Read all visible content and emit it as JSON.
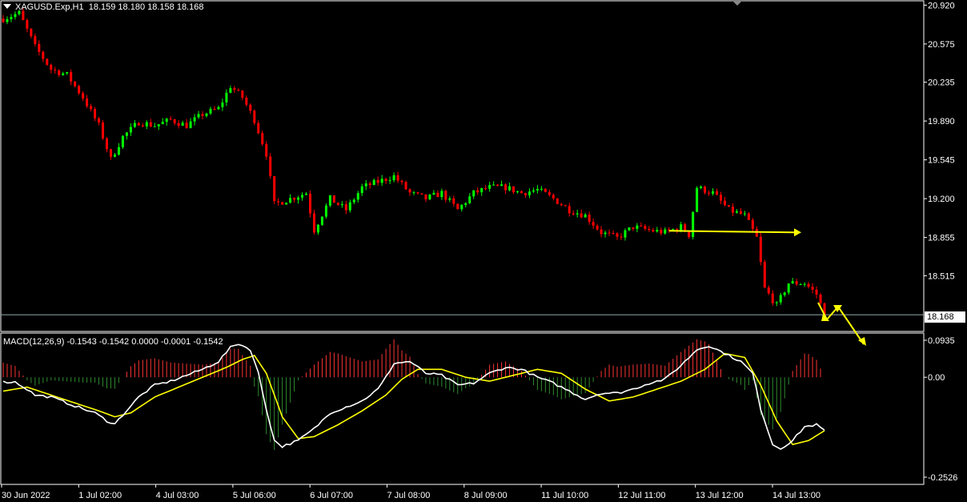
{
  "symbol_header": {
    "symbol": "XAGUSD.Exp,H1",
    "ohlc": "18.159 18.180 18.158 18.168"
  },
  "macd_header": {
    "label": "MACD(12,26,9) -0.1543 -0.1542 0.0000 -0.0001 -0.1542"
  },
  "current_price": "18.168",
  "colors": {
    "background": "#000000",
    "bull_candle": "#00ff00",
    "bear_candle": "#ff0000",
    "macd_line": "#ffffff",
    "signal_line": "#ffff00",
    "histogram_positive": "#ff3333",
    "histogram_negative": "#2e8b2e",
    "annotation": "#ffff00",
    "grid_border": "#ffffff"
  },
  "chart_data": [
    {
      "type": "candlestick",
      "title": "XAGUSD.Exp,H1",
      "timeframe": "H1",
      "y_ticks": [
        "20.920",
        "20.575",
        "20.235",
        "19.890",
        "19.545",
        "19.200",
        "18.855",
        "18.515"
      ],
      "ylim": [
        18.1,
        20.93
      ],
      "x_ticks": [
        "30 Jun 2022",
        "1 Jul 02:00",
        "4 Jul 03:00",
        "5 Jul 06:00",
        "6 Jul 07:00",
        "7 Jul 08:00",
        "8 Jul 09:00",
        "11 Jul 10:00",
        "12 Jul 11:00",
        "13 Jul 12:00",
        "14 Jul 13:00"
      ],
      "close_path": [
        [
          0,
          20.8
        ],
        [
          4,
          20.85
        ],
        [
          8,
          20.55
        ],
        [
          12,
          20.35
        ],
        [
          16,
          20.3
        ],
        [
          20,
          20.1
        ],
        [
          24,
          19.85
        ],
        [
          27,
          19.55
        ],
        [
          30,
          19.75
        ],
        [
          34,
          19.88
        ],
        [
          38,
          19.85
        ],
        [
          42,
          19.9
        ],
        [
          46,
          19.85
        ],
        [
          50,
          19.95
        ],
        [
          54,
          20.0
        ],
        [
          57,
          20.2
        ],
        [
          60,
          20.1
        ],
        [
          63,
          19.9
        ],
        [
          66,
          19.6
        ],
        [
          68,
          19.15
        ],
        [
          72,
          19.2
        ],
        [
          76,
          19.25
        ],
        [
          78,
          18.92
        ],
        [
          82,
          19.2
        ],
        [
          86,
          19.1
        ],
        [
          90,
          19.3
        ],
        [
          94,
          19.35
        ],
        [
          98,
          19.4
        ],
        [
          102,
          19.25
        ],
        [
          106,
          19.2
        ],
        [
          110,
          19.25
        ],
        [
          114,
          19.1
        ],
        [
          118,
          19.25
        ],
        [
          122,
          19.3
        ],
        [
          126,
          19.3
        ],
        [
          130,
          19.25
        ],
        [
          134,
          19.28
        ],
        [
          138,
          19.2
        ],
        [
          142,
          19.1
        ],
        [
          146,
          19.05
        ],
        [
          150,
          18.9
        ],
        [
          154,
          18.85
        ],
        [
          158,
          18.95
        ],
        [
          162,
          18.92
        ],
        [
          166,
          18.9
        ],
        [
          170,
          18.95
        ],
        [
          172,
          18.88
        ],
        [
          174,
          19.3
        ],
        [
          178,
          19.25
        ],
        [
          182,
          19.1
        ],
        [
          186,
          19.05
        ],
        [
          189,
          18.85
        ],
        [
          191,
          18.4
        ],
        [
          194,
          18.25
        ],
        [
          197,
          18.45
        ],
        [
          201,
          18.45
        ],
        [
          204,
          18.35
        ],
        [
          206,
          18.17
        ]
      ],
      "annotations": [
        {
          "type": "horizontal-arrow",
          "price": 18.9
        },
        {
          "type": "projection-arrow",
          "points": [
            [
              18.3
            ],
            [
              18.17
            ],
            [
              18.28
            ],
            [
              17.9
            ]
          ]
        }
      ]
    },
    {
      "type": "line",
      "title": "MACD(12,26,9)",
      "y_ticks": [
        "0.0935",
        "0.00",
        "-0.2526"
      ],
      "ylim": [
        -0.2526,
        0.0935
      ],
      "series": [
        {
          "name": "MACD",
          "kind": "histogram+line",
          "values": [
            [
              0,
              -0.012
            ],
            [
              3,
              -0.012
            ],
            [
              6,
              -0.03
            ],
            [
              8,
              -0.045
            ],
            [
              12,
              -0.05
            ],
            [
              16,
              -0.065
            ],
            [
              20,
              -0.08
            ],
            [
              23,
              -0.09
            ],
            [
              26,
              -0.11
            ],
            [
              28,
              -0.118
            ],
            [
              30,
              -0.095
            ],
            [
              34,
              -0.05
            ],
            [
              38,
              -0.02
            ],
            [
              42,
              -0.01
            ],
            [
              46,
              0.005
            ],
            [
              50,
              0.02
            ],
            [
              54,
              0.04
            ],
            [
              57,
              0.075
            ],
            [
              59,
              0.085
            ],
            [
              62,
              0.07
            ],
            [
              64,
              0.01
            ],
            [
              66,
              -0.08
            ],
            [
              68,
              -0.16
            ],
            [
              70,
              -0.175
            ],
            [
              74,
              -0.16
            ],
            [
              78,
              -0.13
            ],
            [
              82,
              -0.09
            ],
            [
              86,
              -0.075
            ],
            [
              90,
              -0.06
            ],
            [
              94,
              -0.03
            ],
            [
              96,
              0.0
            ],
            [
              98,
              0.035
            ],
            [
              102,
              0.04
            ],
            [
              106,
              0.01
            ],
            [
              110,
              0.005
            ],
            [
              114,
              -0.02
            ],
            [
              118,
              -0.015
            ],
            [
              122,
              0.01
            ],
            [
              126,
              0.025
            ],
            [
              130,
              0.02
            ],
            [
              134,
              0.0
            ],
            [
              138,
              -0.015
            ],
            [
              142,
              -0.035
            ],
            [
              146,
              -0.055
            ],
            [
              150,
              -0.04
            ],
            [
              154,
              -0.04
            ],
            [
              158,
              -0.03
            ],
            [
              162,
              -0.015
            ],
            [
              166,
              -0.005
            ],
            [
              170,
              0.03
            ],
            [
              174,
              0.07
            ],
            [
              177,
              0.08
            ],
            [
              181,
              0.06
            ],
            [
              185,
              0.04
            ],
            [
              188,
              0.01
            ],
            [
              190,
              -0.08
            ],
            [
              193,
              -0.17
            ],
            [
              195,
              -0.18
            ],
            [
              198,
              -0.16
            ],
            [
              201,
              -0.125
            ],
            [
              204,
              -0.12
            ],
            [
              206,
              -0.135
            ]
          ]
        },
        {
          "name": "Signal",
          "kind": "line",
          "values": [
            [
              0,
              -0.035
            ],
            [
              6,
              -0.025
            ],
            [
              12,
              -0.045
            ],
            [
              18,
              -0.065
            ],
            [
              24,
              -0.085
            ],
            [
              28,
              -0.1
            ],
            [
              32,
              -0.09
            ],
            [
              38,
              -0.05
            ],
            [
              44,
              -0.025
            ],
            [
              50,
              0.0
            ],
            [
              56,
              0.025
            ],
            [
              60,
              0.045
            ],
            [
              63,
              0.055
            ],
            [
              66,
              0.01
            ],
            [
              70,
              -0.1
            ],
            [
              74,
              -0.155
            ],
            [
              78,
              -0.15
            ],
            [
              84,
              -0.12
            ],
            [
              90,
              -0.085
            ],
            [
              96,
              -0.045
            ],
            [
              100,
              -0.005
            ],
            [
              104,
              0.02
            ],
            [
              110,
              0.02
            ],
            [
              116,
              0.0
            ],
            [
              122,
              -0.01
            ],
            [
              128,
              0.005
            ],
            [
              134,
              0.02
            ],
            [
              140,
              0.01
            ],
            [
              146,
              -0.03
            ],
            [
              152,
              -0.06
            ],
            [
              158,
              -0.05
            ],
            [
              164,
              -0.03
            ],
            [
              170,
              -0.01
            ],
            [
              176,
              0.02
            ],
            [
              181,
              0.06
            ],
            [
              186,
              0.05
            ],
            [
              190,
              -0.02
            ],
            [
              194,
              -0.11
            ],
            [
              198,
              -0.17
            ],
            [
              202,
              -0.16
            ],
            [
              206,
              -0.135
            ]
          ]
        }
      ]
    }
  ]
}
